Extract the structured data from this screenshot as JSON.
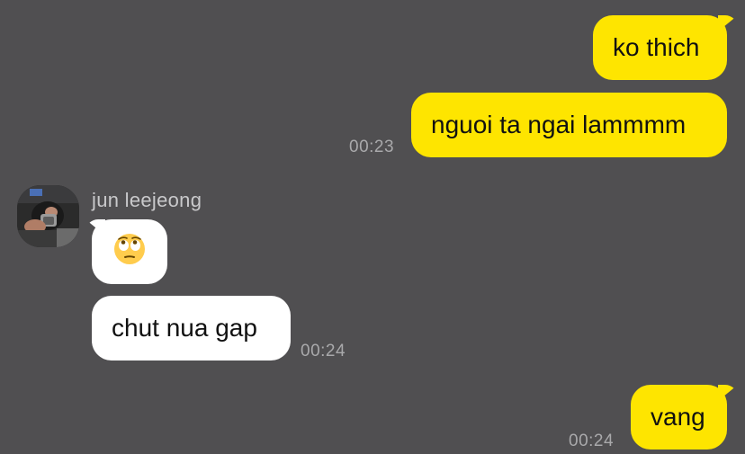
{
  "chat": {
    "messages": [
      {
        "text": "ko thich",
        "time": ""
      },
      {
        "text": "nguoi ta ngai lammmm",
        "time": "00:23"
      },
      {
        "sender": "jun leejeong",
        "emoji": "face-with-rolling-eyes"
      },
      {
        "text": "chut nua gap",
        "time": "00:24"
      },
      {
        "text": "vang",
        "time": "00:24"
      }
    ]
  },
  "colors": {
    "background": "#504f51",
    "outgoing_bubble": "#fee500",
    "incoming_bubble": "#ffffff"
  }
}
